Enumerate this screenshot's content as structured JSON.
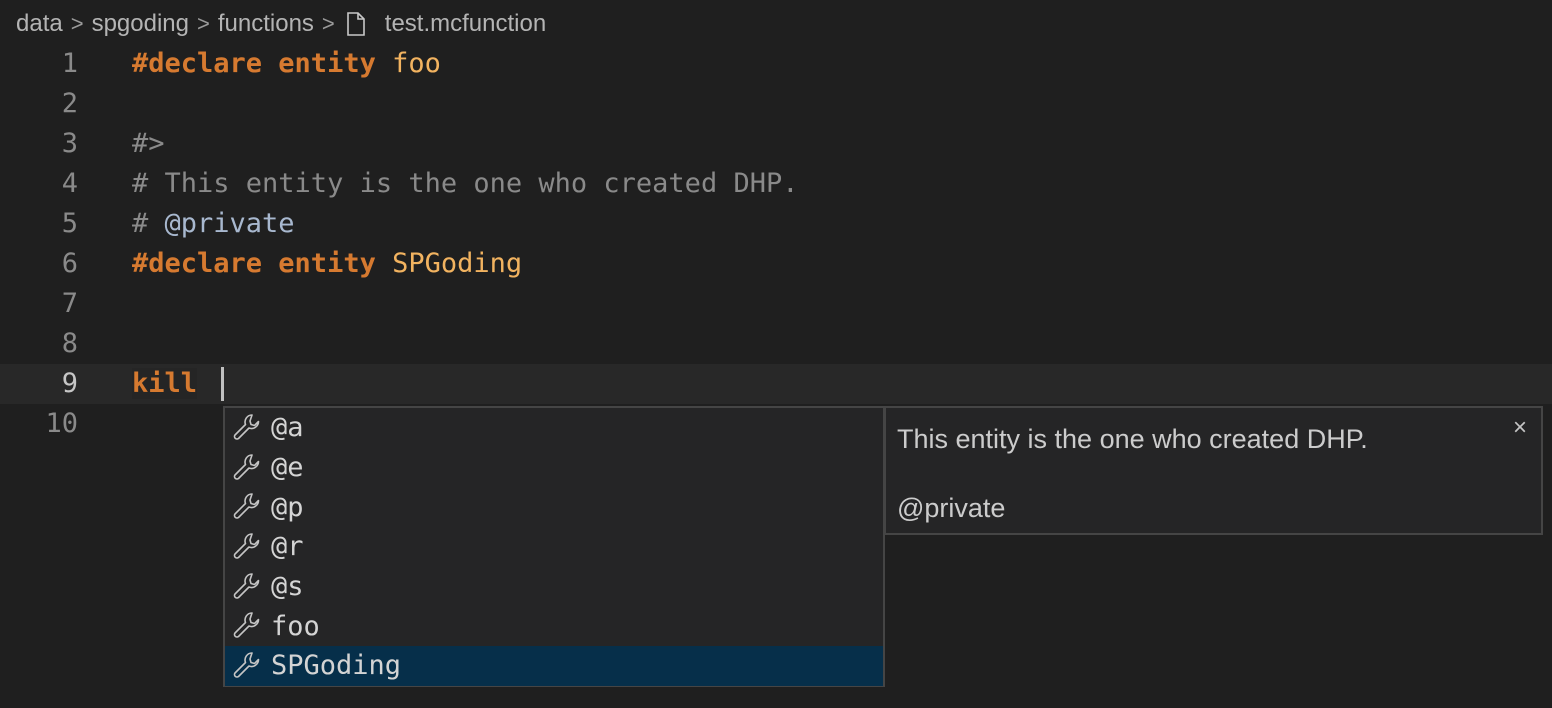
{
  "breadcrumb": {
    "items": [
      "data",
      "spgoding",
      "functions"
    ],
    "separator": ">",
    "file_icon": "file-icon",
    "file_name": "test.mcfunction"
  },
  "editor": {
    "lines": [
      {
        "num": "1",
        "tokens": [
          {
            "t": "#declare entity",
            "c": "kw"
          },
          {
            "t": " "
          },
          {
            "t": "foo",
            "c": "ident"
          }
        ]
      },
      {
        "num": "2",
        "tokens": []
      },
      {
        "num": "3",
        "tokens": [
          {
            "t": "#>",
            "c": "comment"
          }
        ]
      },
      {
        "num": "4",
        "tokens": [
          {
            "t": "# This entity is the one who created DHP.",
            "c": "comment"
          }
        ]
      },
      {
        "num": "5",
        "tokens": [
          {
            "t": "# ",
            "c": "comment"
          },
          {
            "t": "@private",
            "c": "doc-tag"
          }
        ]
      },
      {
        "num": "6",
        "tokens": [
          {
            "t": "#declare entity",
            "c": "kw"
          },
          {
            "t": " "
          },
          {
            "t": "SPGoding",
            "c": "ident"
          }
        ]
      },
      {
        "num": "7",
        "tokens": []
      },
      {
        "num": "8",
        "tokens": []
      },
      {
        "num": "9",
        "tokens": [
          {
            "t": "kill",
            "c": "kw kill-bg"
          },
          {
            "t": " "
          }
        ],
        "current": true
      },
      {
        "num": "10",
        "tokens": []
      }
    ]
  },
  "suggest": {
    "item_icon": "wrench-icon",
    "items": [
      {
        "label": "@a",
        "selected": false
      },
      {
        "label": "@e",
        "selected": false
      },
      {
        "label": "@p",
        "selected": false
      },
      {
        "label": "@r",
        "selected": false
      },
      {
        "label": "@s",
        "selected": false
      },
      {
        "label": "foo",
        "selected": false
      },
      {
        "label": "SPGoding",
        "selected": true
      }
    ]
  },
  "details": {
    "description": "This entity is the one who created DHP.",
    "tag": "@private",
    "close_icon": "×"
  },
  "colors": {
    "background": "#1f1f1f",
    "keyword": "#d67a30",
    "identifier": "#f2b360",
    "comment": "#8a8a8a",
    "doc_tag": "#a8b8cf",
    "selection": "#062f4a"
  }
}
